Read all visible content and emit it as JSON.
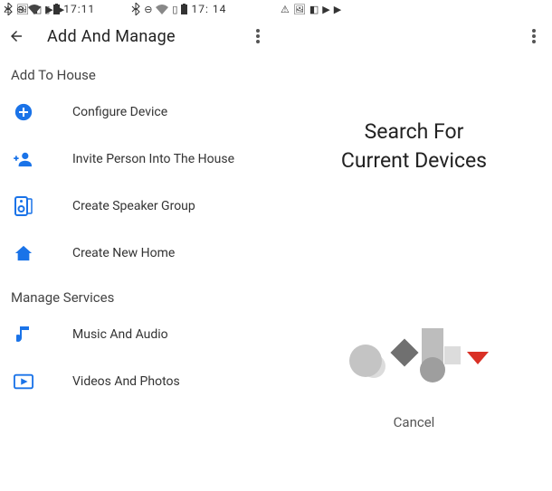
{
  "status_bar_left": {
    "time": "17: 14"
  },
  "status_bar_right": {
    "time": "17:11"
  },
  "header": {
    "title": "Add And Manage"
  },
  "sections": {
    "add_to_house": "Add To House",
    "manage_services": "Manage Services"
  },
  "items": {
    "configure_device": "Configure Device",
    "invite_person": "Invite Person Into The House",
    "speaker_group": "Create Speaker Group",
    "new_home": "Create New Home",
    "music_audio": "Music And Audio",
    "videos_photos": "Videos And Photos"
  },
  "right": {
    "title_line1": "Search For",
    "title_line2": "Current Devices",
    "cancel": "Cancel"
  },
  "colors": {
    "accent": "#1a73e8",
    "red": "#d93025",
    "gray_dark": "#707070",
    "gray_light": "#bdbdbd"
  }
}
